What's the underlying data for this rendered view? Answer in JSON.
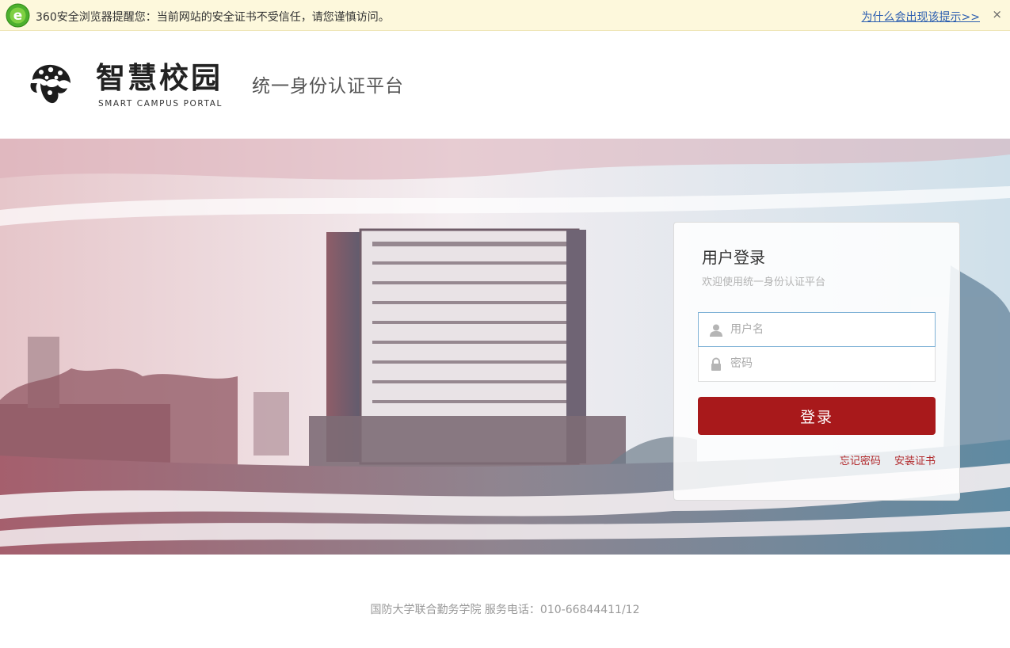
{
  "warning_bar": {
    "message": "360安全浏览器提醒您：当前网站的安全证书不受信任，请您谨慎访问。",
    "why_link": "为什么会出现该提示>>",
    "close_glyph": "×"
  },
  "header": {
    "logo_cn": "智慧校园",
    "logo_en": "SMART CAMPUS PORTAL",
    "platform_title": "统一身份认证平台"
  },
  "login": {
    "title": "用户登录",
    "subtitle": "欢迎使用统一身份认证平台",
    "username_placeholder": "用户名",
    "password_placeholder": "密码",
    "username_icon": "user-icon",
    "password_icon": "lock-icon",
    "submit_label": "登录",
    "forgot_password": "忘记密码",
    "install_cert": "安装证书"
  },
  "footer": {
    "text": "国防大学联合勤务学院 服务电话：010-66844411/12"
  },
  "colors": {
    "accent": "#a8191b",
    "link": "#b1282b",
    "warning_bg": "#fdf8dc",
    "warning_link": "#2a5db0"
  }
}
